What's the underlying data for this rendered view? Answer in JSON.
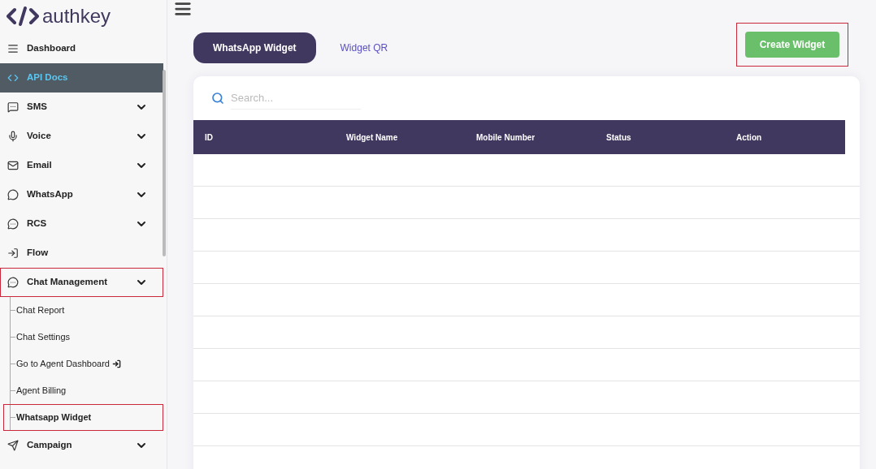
{
  "logo": {
    "text": "authkey"
  },
  "sidebar": {
    "items": [
      {
        "label": "Dashboard",
        "kind": "list",
        "selected": false,
        "expandable": false,
        "highlighted": false
      },
      {
        "label": "API Docs",
        "kind": "code",
        "selected": true,
        "expandable": false,
        "highlighted": false
      },
      {
        "label": "SMS",
        "kind": "sms",
        "selected": false,
        "expandable": true,
        "highlighted": false
      },
      {
        "label": "Voice",
        "kind": "mic",
        "selected": false,
        "expandable": true,
        "highlighted": false
      },
      {
        "label": "Email",
        "kind": "mail",
        "selected": false,
        "expandable": true,
        "highlighted": false
      },
      {
        "label": "WhatsApp",
        "kind": "whatsapp",
        "selected": false,
        "expandable": true,
        "highlighted": false
      },
      {
        "label": "RCS",
        "kind": "rcs",
        "selected": false,
        "expandable": true,
        "highlighted": false
      },
      {
        "label": "Flow",
        "kind": "flow",
        "selected": false,
        "expandable": false,
        "highlighted": false
      },
      {
        "label": "Chat Management",
        "kind": "chat",
        "selected": false,
        "expandable": true,
        "highlighted": true,
        "children": [
          {
            "label": "Chat Report",
            "selected": false,
            "highlighted": false,
            "external": false
          },
          {
            "label": "Chat Settings",
            "selected": false,
            "highlighted": false,
            "external": false
          },
          {
            "label": "Go to Agent Dashboard",
            "selected": false,
            "highlighted": false,
            "external": true
          },
          {
            "label": "Agent Billing",
            "selected": false,
            "highlighted": false,
            "external": false
          },
          {
            "label": "Whatsapp Widget",
            "selected": true,
            "highlighted": true,
            "external": false
          }
        ]
      },
      {
        "label": "Campaign",
        "kind": "send",
        "selected": false,
        "expandable": true,
        "highlighted": false
      }
    ]
  },
  "tabs": [
    {
      "label": "WhatsApp Widget",
      "selected": true
    },
    {
      "label": "Widget QR",
      "selected": false
    }
  ],
  "create_button": {
    "label": "Create Widget",
    "highlighted": true
  },
  "search": {
    "placeholder": "Search..."
  },
  "table": {
    "columns": [
      "ID",
      "Widget Name",
      "Mobile Number",
      "Status",
      "Action"
    ]
  }
}
